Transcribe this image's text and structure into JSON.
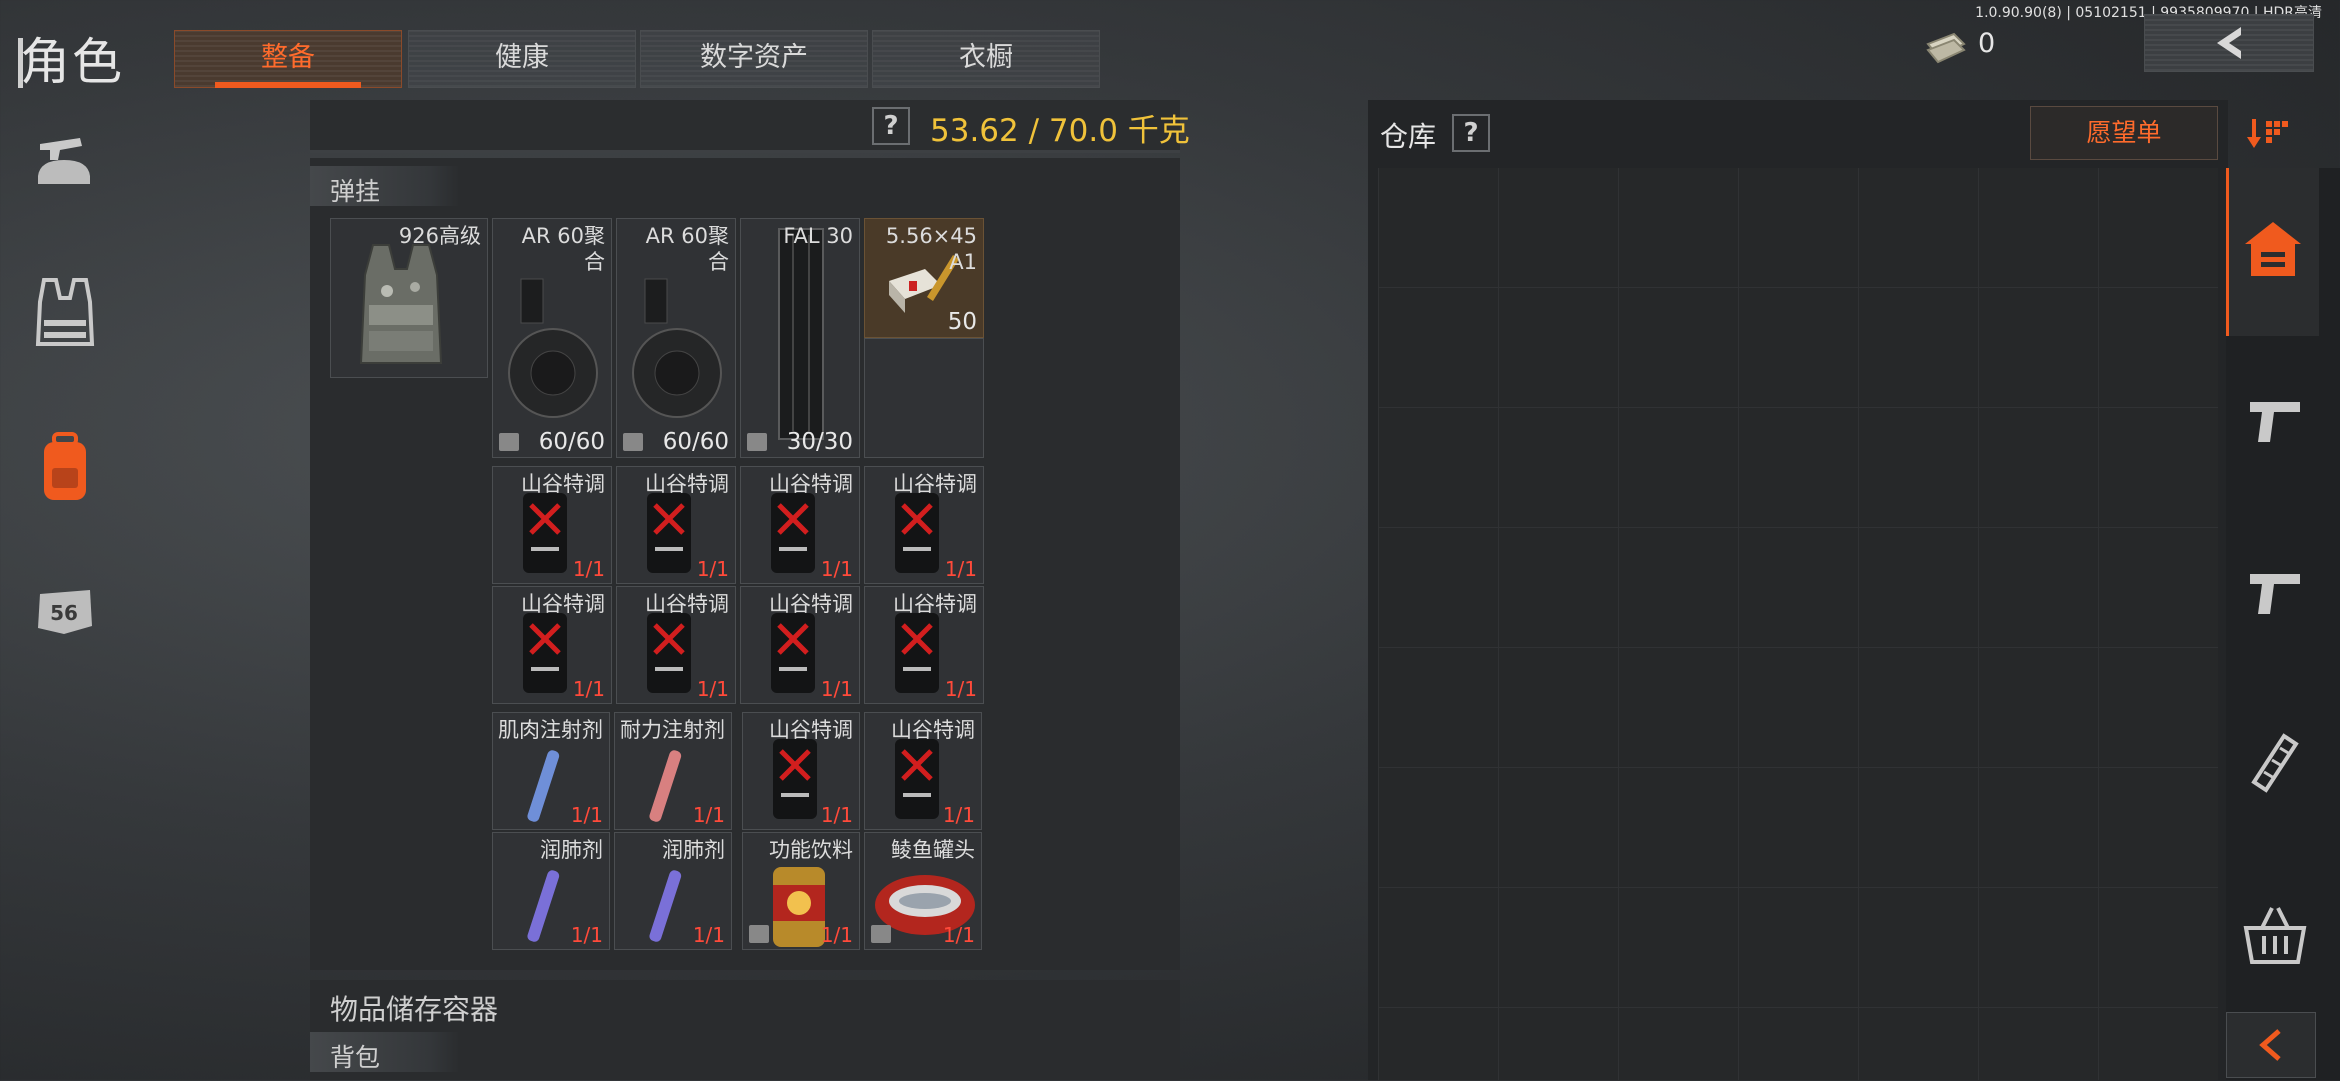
{
  "header": {
    "title": "角色",
    "tabs": [
      {
        "label": "整备",
        "active": true
      },
      {
        "label": "健康",
        "active": false
      },
      {
        "label": "数字资产",
        "active": false
      },
      {
        "label": "衣橱",
        "active": false
      }
    ],
    "version": "1.0.90.90(8) | 05102151 | 9935809970 | HDR高清",
    "money": "0"
  },
  "left_nav": [
    {
      "icon": "weapon-helmet-icon",
      "active": false
    },
    {
      "icon": "vest-icon",
      "active": false
    },
    {
      "icon": "backpack-icon",
      "active": true
    },
    {
      "icon": "badge-icon",
      "label": "56",
      "active": false
    }
  ],
  "loadout": {
    "help": "?",
    "weight": "53.62 / 70.0 千克",
    "rig_section": "弹挂",
    "rig_item": {
      "name": "926高级"
    },
    "slots_row1": [
      {
        "name": "AR 60聚合",
        "count": "60/60",
        "kind": "drum"
      },
      {
        "name": "AR 60聚合",
        "count": "60/60",
        "kind": "drum"
      },
      {
        "name": "FAL 30",
        "count": "30/30",
        "kind": "mag"
      },
      {
        "name": "5.56×45 A1",
        "count": "50",
        "kind": "ammo"
      }
    ],
    "consumables": [
      {
        "name": "山谷特调",
        "count": "1/1",
        "kind": "can"
      },
      {
        "name": "山谷特调",
        "count": "1/1",
        "kind": "can"
      },
      {
        "name": "山谷特调",
        "count": "1/1",
        "kind": "can"
      },
      {
        "name": "山谷特调",
        "count": "1/1",
        "kind": "can"
      },
      {
        "name": "山谷特调",
        "count": "1/1",
        "kind": "can"
      },
      {
        "name": "山谷特调",
        "count": "1/1",
        "kind": "can"
      },
      {
        "name": "山谷特调",
        "count": "1/1",
        "kind": "can"
      },
      {
        "name": "山谷特调",
        "count": "1/1",
        "kind": "can"
      }
    ],
    "consumables2": [
      {
        "name": "肌肉注射剂",
        "count": "1/1",
        "kind": "syringe-blue"
      },
      {
        "name": "耐力注射剂",
        "count": "1/1",
        "kind": "syringe-red"
      },
      {
        "name": "山谷特调",
        "count": "1/1",
        "kind": "can"
      },
      {
        "name": "山谷特调",
        "count": "1/1",
        "kind": "can"
      },
      {
        "name": "润肺剂",
        "count": "1/1",
        "kind": "syringe-purple"
      },
      {
        "name": "润肺剂",
        "count": "1/1",
        "kind": "syringe-purple"
      },
      {
        "name": "功能饮料",
        "count": "1/1",
        "kind": "drink"
      },
      {
        "name": "鲮鱼罐头",
        "count": "1/1",
        "kind": "fishcan"
      }
    ],
    "container_section": "物品储存容器",
    "bag_section": "背包"
  },
  "warehouse": {
    "title": "仓库",
    "help": "?",
    "wishlist": "愿望单"
  },
  "right_rail": [
    {
      "icon": "home-icon",
      "active": true
    },
    {
      "icon": "pistol-icon",
      "active": false
    },
    {
      "icon": "pistol-icon",
      "active": false
    },
    {
      "icon": "magazine-icon",
      "active": false
    },
    {
      "icon": "basket-icon",
      "active": false
    },
    {
      "icon": "collapse-arrow-icon",
      "active": false
    }
  ],
  "colors": {
    "accent": "#f05a1e",
    "weight": "#f0c23a",
    "count_red": "#ff4a3a"
  }
}
